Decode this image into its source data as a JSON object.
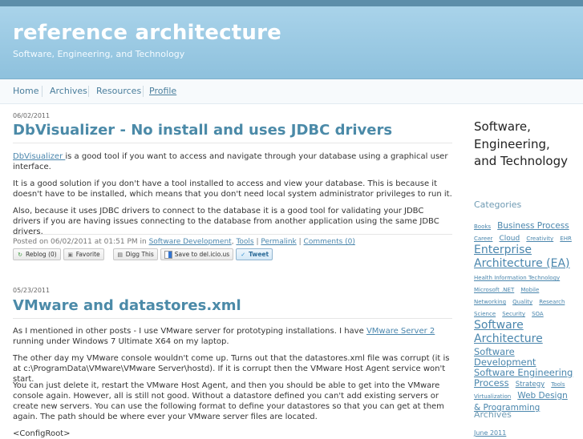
{
  "header": {
    "title": "reference architecture",
    "tagline": "Software, Engineering, and Technology"
  },
  "nav": {
    "items": [
      "Home",
      "Archives",
      "Resources",
      "Profile"
    ]
  },
  "posts": [
    {
      "date": "06/02/2011",
      "title": "DbVisualizer - No install and uses JDBC drivers",
      "p1_link": "DbVisualizer ",
      "p1_rest": "is a good tool if you want to access and navigate through your database using a graphical user interface.",
      "p2": "It is a good solution if you don't have a tool installed to access and view your database. This is because it doesn't have to be installed, which means that you don't need local system administrator privileges to run it.",
      "p3": "Also, because it uses JDBC drivers to connect to the database it is a good tool for validating your JDBC drivers if you are having issues connecting to the database from another application using the same JDBC drivers.",
      "meta": {
        "posted_prefix": "Posted on 06/02/2011 at 01:51 PM in ",
        "cat1": "Software Development",
        "comma": ", ",
        "cat2": "Tools",
        "sep1": " | ",
        "permalink": "Permalink",
        "sep2": " | ",
        "comments": "Comments (0)"
      },
      "share": {
        "reblog": "Reblog (0)",
        "favorite": "Favorite",
        "digg": "Digg This",
        "delicious": "Save to del.icio.us",
        "tweet": "Tweet"
      }
    },
    {
      "date": "05/23/2011",
      "title": "VMware and datastores.xml",
      "p1_pre": "As I mentioned in other posts - I use VMware server for prototyping installations. I have ",
      "p1_link": "VMware Server 2",
      "p1_post": " running under Windows 7 Ultimate X64 on my laptop.",
      "p2": "The other day my VMware console wouldn't come up. Turns out that the datastores.xml file was corrupt (it is at c:\\ProgramData\\VMware\\VMware Server\\hostd). If it is corrupt then the VMware Host Agent service won't start.",
      "p3": "You can just delete it, restart the VMware Host Agent, and then you should be able to get into the VMware console again. However, all is still not good. Without a datastore defined you can't add existing servers or create new servers. You can use the following format to define your datastores so that you can get at them again. The path should be where ever your VMware server files are located.",
      "p4": "<ConfigRoot>"
    }
  ],
  "sidebar": {
    "title": "Software, Engineering, and Technology",
    "categories_heading": "Categories",
    "tags": [
      {
        "label": "Books",
        "size": "t7"
      },
      {
        "label": "Business Process",
        "size": "t10"
      },
      {
        "label": "Career",
        "size": "t7"
      },
      {
        "label": "Cloud",
        "size": "t9"
      },
      {
        "label": "Creativity",
        "size": "t7"
      },
      {
        "label": "EHR",
        "size": "t7"
      },
      {
        "label": "Enterprise Architecture (EA)",
        "size": "t14"
      },
      {
        "label": "Health Information Technology",
        "size": "t7"
      },
      {
        "label": "Microsoft .NET",
        "size": "t7"
      },
      {
        "label": "Mobile",
        "size": "t7"
      },
      {
        "label": "Networking",
        "size": "t7"
      },
      {
        "label": "Quality",
        "size": "t7"
      },
      {
        "label": "Research",
        "size": "t7"
      },
      {
        "label": "Science",
        "size": "t7"
      },
      {
        "label": "Security",
        "size": "t7"
      },
      {
        "label": "SOA",
        "size": "t7"
      },
      {
        "label": "Software Architecture",
        "size": "t14"
      },
      {
        "label": "Software Development",
        "size": "t12"
      },
      {
        "label": "Software Engineering Process",
        "size": "t12"
      },
      {
        "label": "Strategy",
        "size": "t8"
      },
      {
        "label": "Tools",
        "size": "t7"
      },
      {
        "label": "Virtualization",
        "size": "t7"
      },
      {
        "label": "Web Design & Programming",
        "size": "t10"
      }
    ],
    "archives_heading": "Archives",
    "archives": [
      "June 2011"
    ]
  },
  "colors": {
    "header_bg": "#9ccbe4",
    "title_link": "#4b8aa8",
    "link": "#4a86ad"
  }
}
